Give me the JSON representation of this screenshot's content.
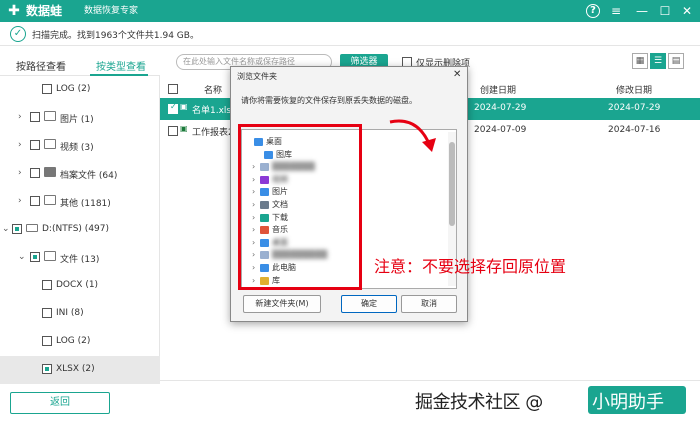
{
  "app": {
    "logo_glyph": "✚",
    "name": "数据蛙",
    "subtitle": "数据恢复专家",
    "accent": "#1aa590",
    "controls": {
      "help": "?",
      "menu": "≡",
      "minimize": "—",
      "maximize": "☐",
      "close": "✕"
    }
  },
  "status": {
    "text": "扫描完成。找到1963个文件共1.94 GB。",
    "icon": "check-circle-icon"
  },
  "tabs": [
    {
      "label": "按路径查看"
    },
    {
      "label": "按类型查看"
    }
  ],
  "tree": [
    {
      "label": "LOG (2)",
      "arrow": "",
      "icon": ""
    },
    {
      "label": "图片 (1)",
      "arrow": "›",
      "icon": "🖼"
    },
    {
      "label": "视频 (3)",
      "arrow": "›",
      "icon": "▶"
    },
    {
      "label": "档案文件 (64)",
      "arrow": "›",
      "icon": "▣"
    },
    {
      "label": "其他 (1181)",
      "arrow": "›",
      "icon": "▭"
    },
    {
      "label": "D:(NTFS) (497)",
      "arrow": "⌄",
      "icon": "▭"
    },
    {
      "label": "文件 (13)",
      "arrow": "⌄",
      "icon": "▤"
    },
    {
      "label": "DOCX (1)",
      "arrow": "",
      "icon": ""
    },
    {
      "label": "INI (8)",
      "arrow": "",
      "icon": ""
    },
    {
      "label": "LOG (2)",
      "arrow": "",
      "icon": ""
    },
    {
      "label": "XLSX (2)",
      "arrow": "",
      "icon": ""
    }
  ],
  "back_button": "返回",
  "toolbar": {
    "search_placeholder": "在此处输入文件名称或保存路径",
    "filter_button": "筛选器",
    "deleted_only_label": "仅显示删除项",
    "view_grid": "▦",
    "view_list": "☰",
    "view_detail": "▤"
  },
  "table": {
    "headers": {
      "name": "名称",
      "created": "创建日期",
      "modified": "修改日期"
    },
    "rows": [
      {
        "name": "名单1.xlsx",
        "created": "2024-07-29",
        "modified": "2024-07-29"
      },
      {
        "name": "工作报表20",
        "created": "2024-07-09",
        "modified": "2024-07-16"
      }
    ]
  },
  "dialog": {
    "title": "浏览文件夹",
    "close": "✕",
    "prompt": "请你将需要恢复的文件保存到原丢失数据的磁盘。",
    "folders": [
      {
        "label": "桌面",
        "chev": "",
        "color": "#3a8ee6",
        "blur": false
      },
      {
        "label": "图库",
        "chev": "",
        "color": "#3a8ee6",
        "blur": false
      },
      {
        "label": "▒▒▒▒▒▒▒",
        "chev": "›",
        "color": "#9ab0d0",
        "blur": true
      },
      {
        "label": "视频",
        "chev": "›",
        "color": "#8b3ad6",
        "blur": true
      },
      {
        "label": "图片",
        "chev": "›",
        "color": "#3a8ee6",
        "blur": false
      },
      {
        "label": "文档",
        "chev": "›",
        "color": "#6b7b8c",
        "blur": false
      },
      {
        "label": "下载",
        "chev": "›",
        "color": "#1aa590",
        "blur": false
      },
      {
        "label": "音乐",
        "chev": "›",
        "color": "#e0543a",
        "blur": false
      },
      {
        "label": "桌面",
        "chev": "›",
        "color": "#3a8ee6",
        "blur": true
      },
      {
        "label": "▒▒▒▒▒▒▒▒▒",
        "chev": "›",
        "color": "#9ab0d0",
        "blur": true
      },
      {
        "label": "此电脑",
        "chev": "›",
        "color": "#3a8ee6",
        "blur": false
      },
      {
        "label": "库",
        "chev": "›",
        "color": "#e0b030",
        "blur": false
      }
    ],
    "new_folder_button": "新建文件夹(M)",
    "ok_button": "确定",
    "cancel_button": "取消"
  },
  "annotation": {
    "note": "注意：不要选择存回原位置",
    "color": "#e60012"
  },
  "watermark": {
    "text": "掘金技术社区 @",
    "badge": "小明助手"
  }
}
